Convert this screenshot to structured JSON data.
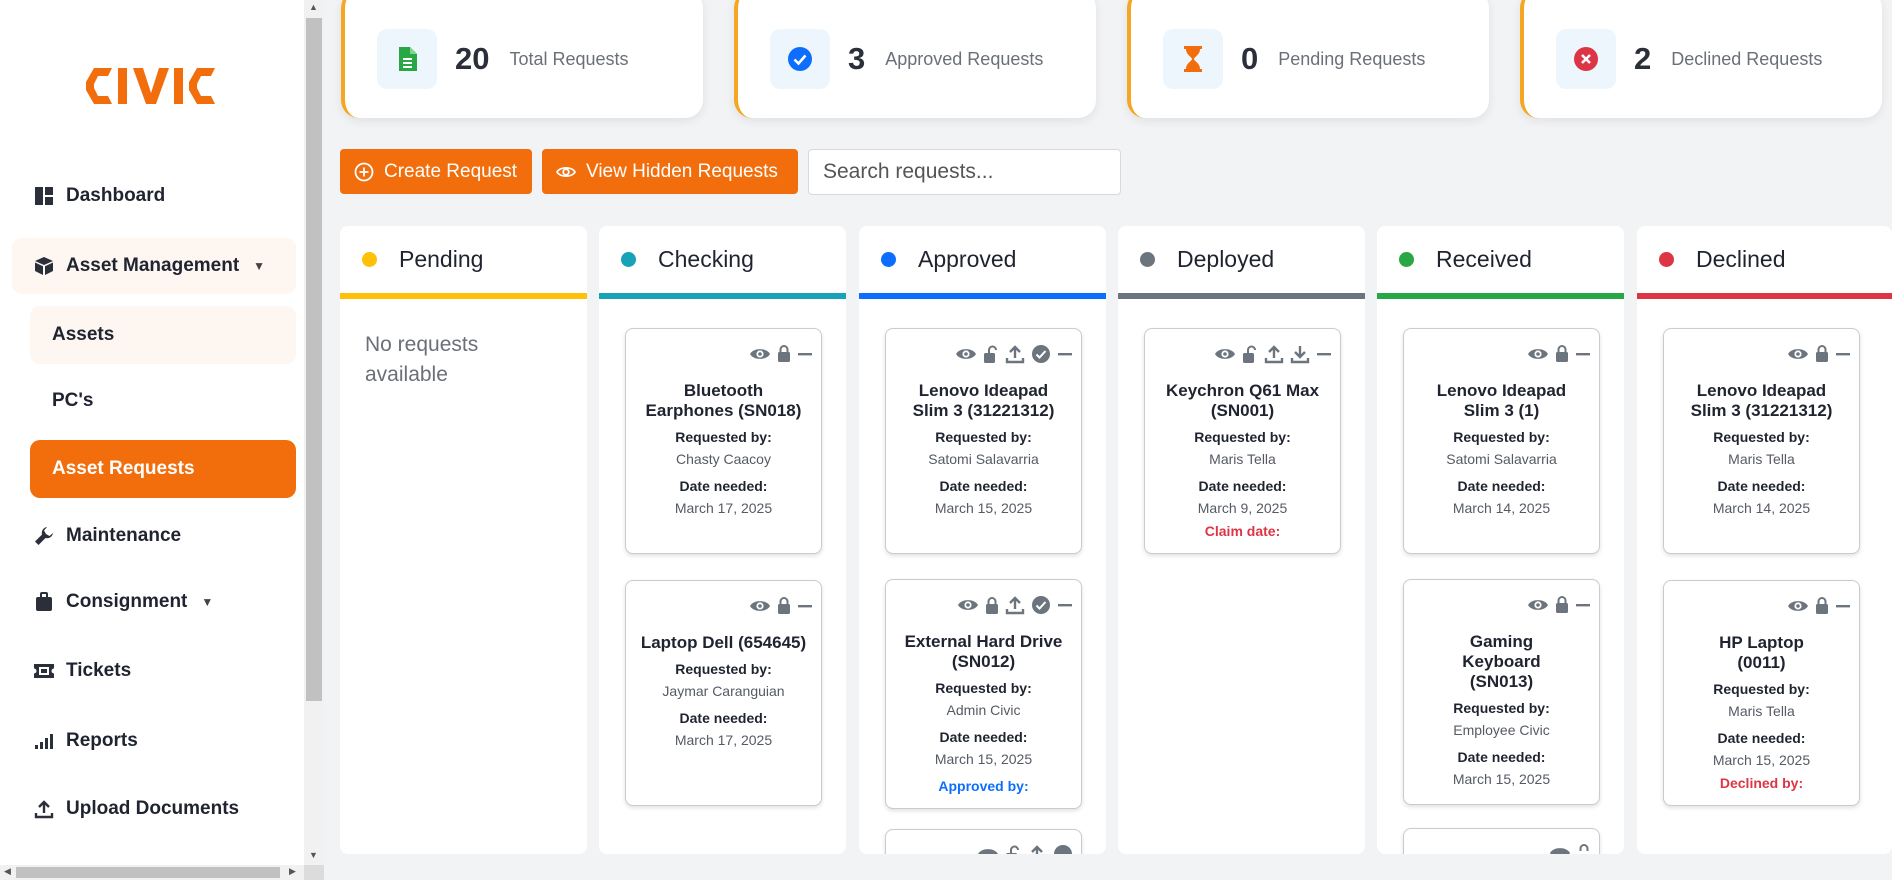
{
  "brand": {
    "logo_text": "CIVIC",
    "accent": "#f26e0c"
  },
  "sidebar": {
    "dashboard": "Dashboard",
    "asset_management": "Asset Management",
    "assets": "Assets",
    "pcs": "PC's",
    "asset_requests": "Asset Requests",
    "maintenance": "Maintenance",
    "consignment": "Consignment",
    "tickets": "Tickets",
    "reports": "Reports",
    "upload_documents": "Upload Documents"
  },
  "stats": [
    {
      "value": "20",
      "label": "Total Requests",
      "icon": "document-icon",
      "color": "#28a745"
    },
    {
      "value": "3",
      "label": "Approved Requests",
      "icon": "check-circle-icon",
      "color": "#0d6efd"
    },
    {
      "value": "0",
      "label": "Pending Requests",
      "icon": "hourglass-icon",
      "color": "#f26e0c"
    },
    {
      "value": "2",
      "label": "Declined Requests",
      "icon": "x-circle-icon",
      "color": "#dc3545"
    }
  ],
  "toolbar": {
    "create_label": "Create Request",
    "hidden_label": "View Hidden Requests",
    "search_placeholder": "Search requests..."
  },
  "columns": {
    "pending": {
      "title": "Pending",
      "color": "#ffc107",
      "empty_text": "No requests available"
    },
    "checking": {
      "title": "Checking",
      "color": "#17a2b8"
    },
    "approved": {
      "title": "Approved",
      "color": "#0d6efd"
    },
    "deployed": {
      "title": "Deployed",
      "color": "#6c757d"
    },
    "received": {
      "title": "Received",
      "color": "#28a745"
    },
    "declined": {
      "title": "Declined",
      "color": "#dc3545"
    }
  },
  "labels": {
    "requested_by": "Requested by:",
    "date_needed": "Date needed:",
    "claim_date": "Claim date:",
    "approved_by": "Approved by:",
    "declined_by": "Declined by:"
  },
  "cards": {
    "checking": [
      {
        "title": "Bluetooth Earphones (SN018)",
        "requester": "Chasty Caacoy",
        "date": "March 17, 2025"
      },
      {
        "title": "Laptop Dell (654645)",
        "requester": "Jaymar Caranguian",
        "date": "March 17, 2025"
      }
    ],
    "approved": [
      {
        "title": "Lenovo Ideapad Slim 3 (31221312)",
        "requester": "Satomi Salavarria",
        "date": "March 15, 2025"
      },
      {
        "title": "External Hard Drive (SN012)",
        "requester": "Admin Civic",
        "date": "March 15, 2025"
      }
    ],
    "deployed": [
      {
        "title": "Keychron Q61 Max (SN001)",
        "requester": "Maris Tella",
        "date": "March 9, 2025"
      }
    ],
    "received": [
      {
        "title": "Lenovo Ideapad Slim 3 (1)",
        "requester": "Satomi Salavarria",
        "date": "March 14, 2025"
      },
      {
        "title": "Gaming Keyboard (SN013)",
        "requester": "Employee Civic",
        "date": "March 15, 2025"
      }
    ],
    "declined": [
      {
        "title": "Lenovo Ideapad Slim 3 (31221312)",
        "requester": "Maris Tella",
        "date": "March 14, 2025"
      },
      {
        "title": "HP Laptop (0011)",
        "requester": "Maris Tella",
        "date": "March 15, 2025"
      }
    ]
  }
}
